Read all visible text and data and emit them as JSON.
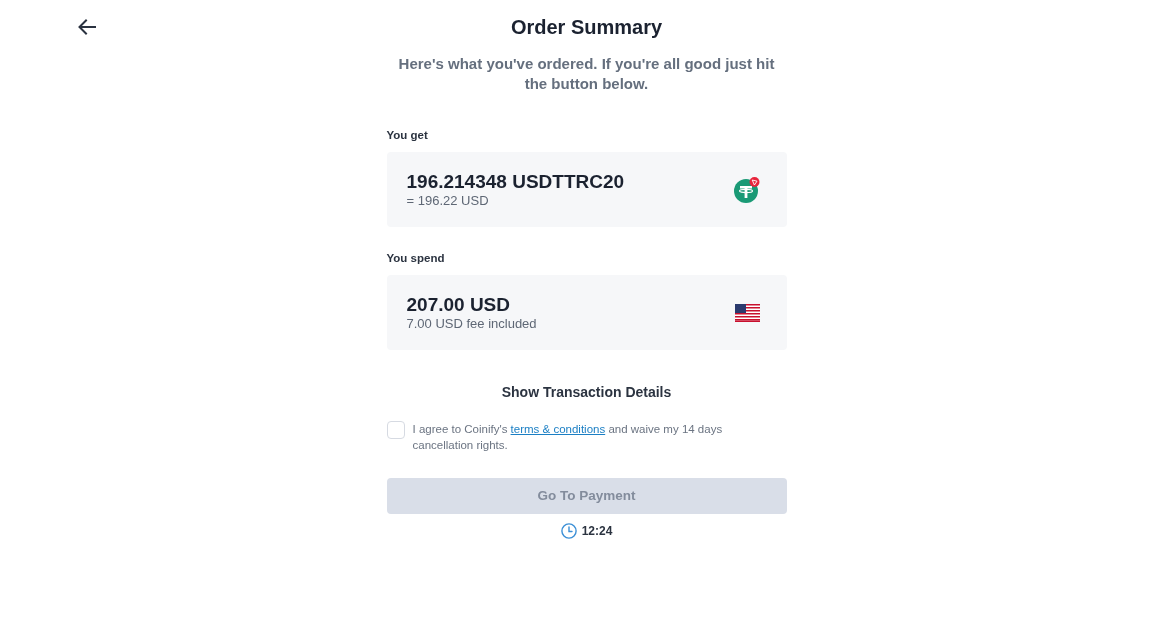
{
  "header": {
    "title": "Order Summary",
    "subtitle": "Here's what you've ordered. If you're all good just hit the button below."
  },
  "sections": [
    {
      "label": "You get",
      "amount": "196.214348 USDTTRC20",
      "note": "= 196.22 USD",
      "kind": "crypto"
    },
    {
      "label": "You spend",
      "amount": "207.00 USD",
      "note": "7.00 USD fee included",
      "kind": "fiat"
    }
  ],
  "details_toggle": "Show Transaction Details",
  "agreement": {
    "checked": false,
    "text_before": "I agree to Coinify's",
    "link": "terms & conditions",
    "text_after": "and waive my 14 days cancellation rights."
  },
  "primary_button": {
    "label": "Go To Payment",
    "disabled": true
  },
  "timer": "12:24"
}
